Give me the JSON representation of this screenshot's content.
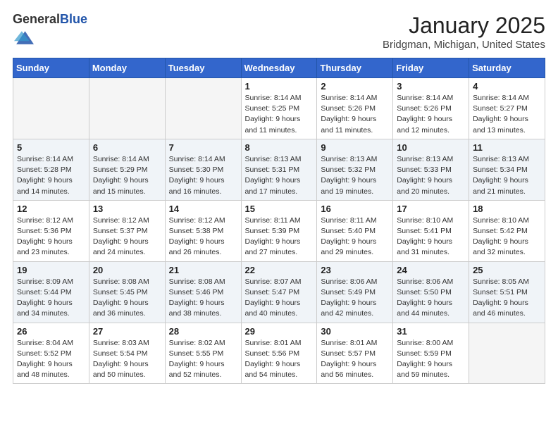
{
  "header": {
    "logo_general": "General",
    "logo_blue": "Blue",
    "title": "January 2025",
    "subtitle": "Bridgman, Michigan, United States"
  },
  "days_of_week": [
    "Sunday",
    "Monday",
    "Tuesday",
    "Wednesday",
    "Thursday",
    "Friday",
    "Saturday"
  ],
  "weeks": [
    [
      {
        "day": "",
        "info": ""
      },
      {
        "day": "",
        "info": ""
      },
      {
        "day": "",
        "info": ""
      },
      {
        "day": "1",
        "info": "Sunrise: 8:14 AM\nSunset: 5:25 PM\nDaylight: 9 hours\nand 11 minutes."
      },
      {
        "day": "2",
        "info": "Sunrise: 8:14 AM\nSunset: 5:26 PM\nDaylight: 9 hours\nand 11 minutes."
      },
      {
        "day": "3",
        "info": "Sunrise: 8:14 AM\nSunset: 5:26 PM\nDaylight: 9 hours\nand 12 minutes."
      },
      {
        "day": "4",
        "info": "Sunrise: 8:14 AM\nSunset: 5:27 PM\nDaylight: 9 hours\nand 13 minutes."
      }
    ],
    [
      {
        "day": "5",
        "info": "Sunrise: 8:14 AM\nSunset: 5:28 PM\nDaylight: 9 hours\nand 14 minutes."
      },
      {
        "day": "6",
        "info": "Sunrise: 8:14 AM\nSunset: 5:29 PM\nDaylight: 9 hours\nand 15 minutes."
      },
      {
        "day": "7",
        "info": "Sunrise: 8:14 AM\nSunset: 5:30 PM\nDaylight: 9 hours\nand 16 minutes."
      },
      {
        "day": "8",
        "info": "Sunrise: 8:13 AM\nSunset: 5:31 PM\nDaylight: 9 hours\nand 17 minutes."
      },
      {
        "day": "9",
        "info": "Sunrise: 8:13 AM\nSunset: 5:32 PM\nDaylight: 9 hours\nand 19 minutes."
      },
      {
        "day": "10",
        "info": "Sunrise: 8:13 AM\nSunset: 5:33 PM\nDaylight: 9 hours\nand 20 minutes."
      },
      {
        "day": "11",
        "info": "Sunrise: 8:13 AM\nSunset: 5:34 PM\nDaylight: 9 hours\nand 21 minutes."
      }
    ],
    [
      {
        "day": "12",
        "info": "Sunrise: 8:12 AM\nSunset: 5:36 PM\nDaylight: 9 hours\nand 23 minutes."
      },
      {
        "day": "13",
        "info": "Sunrise: 8:12 AM\nSunset: 5:37 PM\nDaylight: 9 hours\nand 24 minutes."
      },
      {
        "day": "14",
        "info": "Sunrise: 8:12 AM\nSunset: 5:38 PM\nDaylight: 9 hours\nand 26 minutes."
      },
      {
        "day": "15",
        "info": "Sunrise: 8:11 AM\nSunset: 5:39 PM\nDaylight: 9 hours\nand 27 minutes."
      },
      {
        "day": "16",
        "info": "Sunrise: 8:11 AM\nSunset: 5:40 PM\nDaylight: 9 hours\nand 29 minutes."
      },
      {
        "day": "17",
        "info": "Sunrise: 8:10 AM\nSunset: 5:41 PM\nDaylight: 9 hours\nand 31 minutes."
      },
      {
        "day": "18",
        "info": "Sunrise: 8:10 AM\nSunset: 5:42 PM\nDaylight: 9 hours\nand 32 minutes."
      }
    ],
    [
      {
        "day": "19",
        "info": "Sunrise: 8:09 AM\nSunset: 5:44 PM\nDaylight: 9 hours\nand 34 minutes."
      },
      {
        "day": "20",
        "info": "Sunrise: 8:08 AM\nSunset: 5:45 PM\nDaylight: 9 hours\nand 36 minutes."
      },
      {
        "day": "21",
        "info": "Sunrise: 8:08 AM\nSunset: 5:46 PM\nDaylight: 9 hours\nand 38 minutes."
      },
      {
        "day": "22",
        "info": "Sunrise: 8:07 AM\nSunset: 5:47 PM\nDaylight: 9 hours\nand 40 minutes."
      },
      {
        "day": "23",
        "info": "Sunrise: 8:06 AM\nSunset: 5:49 PM\nDaylight: 9 hours\nand 42 minutes."
      },
      {
        "day": "24",
        "info": "Sunrise: 8:06 AM\nSunset: 5:50 PM\nDaylight: 9 hours\nand 44 minutes."
      },
      {
        "day": "25",
        "info": "Sunrise: 8:05 AM\nSunset: 5:51 PM\nDaylight: 9 hours\nand 46 minutes."
      }
    ],
    [
      {
        "day": "26",
        "info": "Sunrise: 8:04 AM\nSunset: 5:52 PM\nDaylight: 9 hours\nand 48 minutes."
      },
      {
        "day": "27",
        "info": "Sunrise: 8:03 AM\nSunset: 5:54 PM\nDaylight: 9 hours\nand 50 minutes."
      },
      {
        "day": "28",
        "info": "Sunrise: 8:02 AM\nSunset: 5:55 PM\nDaylight: 9 hours\nand 52 minutes."
      },
      {
        "day": "29",
        "info": "Sunrise: 8:01 AM\nSunset: 5:56 PM\nDaylight: 9 hours\nand 54 minutes."
      },
      {
        "day": "30",
        "info": "Sunrise: 8:01 AM\nSunset: 5:57 PM\nDaylight: 9 hours\nand 56 minutes."
      },
      {
        "day": "31",
        "info": "Sunrise: 8:00 AM\nSunset: 5:59 PM\nDaylight: 9 hours\nand 59 minutes."
      },
      {
        "day": "",
        "info": ""
      }
    ]
  ]
}
